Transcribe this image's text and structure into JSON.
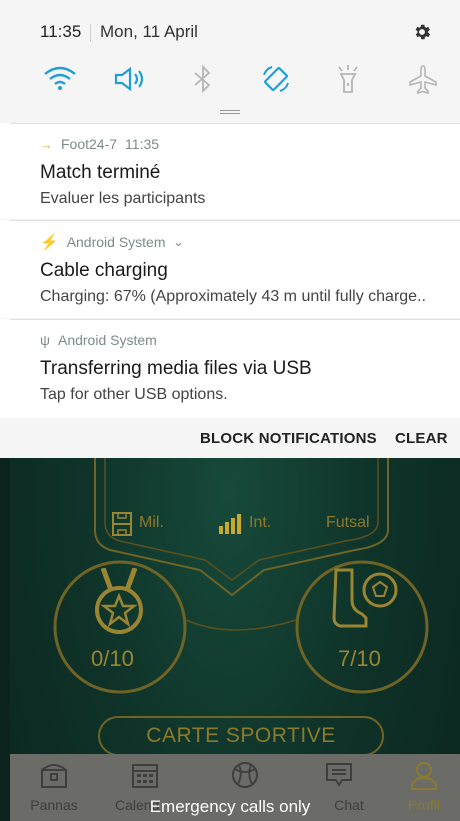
{
  "status": {
    "time": "11:35",
    "date": "Mon, 11 April"
  },
  "quick_settings": [
    {
      "name": "wifi",
      "active": true
    },
    {
      "name": "sound",
      "active": true
    },
    {
      "name": "bluetooth",
      "active": false
    },
    {
      "name": "auto-rotate",
      "active": true
    },
    {
      "name": "flashlight",
      "active": false
    },
    {
      "name": "airplane-mode",
      "active": false
    }
  ],
  "notifications": [
    {
      "app": "Foot24-7",
      "time": "11:35",
      "title": "Match terminé",
      "text": "Evaluer les participants"
    },
    {
      "app": "Android System",
      "title": "Cable charging",
      "text": "Charging: 67% (Approximately 43 m until fully charge.."
    },
    {
      "app": "Android System",
      "title": "Transferring media files via USB",
      "text": "Tap for other USB options."
    }
  ],
  "actions": {
    "block": "BLOCK NOTIFICATIONS",
    "clear": "CLEAR"
  },
  "app": {
    "positions": {
      "mil": "Mil.",
      "int": "Int.",
      "futsal": "Futsal"
    },
    "medals": "0/10",
    "matches": "7/10",
    "carte_button": "CARTE SPORTIVE"
  },
  "nav": {
    "pannas": "Pannas",
    "calendar": "Calend",
    "chat": "Chat",
    "profil": "Profil"
  },
  "emergency": "Emergency calls only",
  "colors": {
    "accent_blue": "#1f9fd6",
    "gold": "#8c7a2e",
    "panel_bg": "#f5f5f5",
    "app_bg": "#0f3329"
  }
}
